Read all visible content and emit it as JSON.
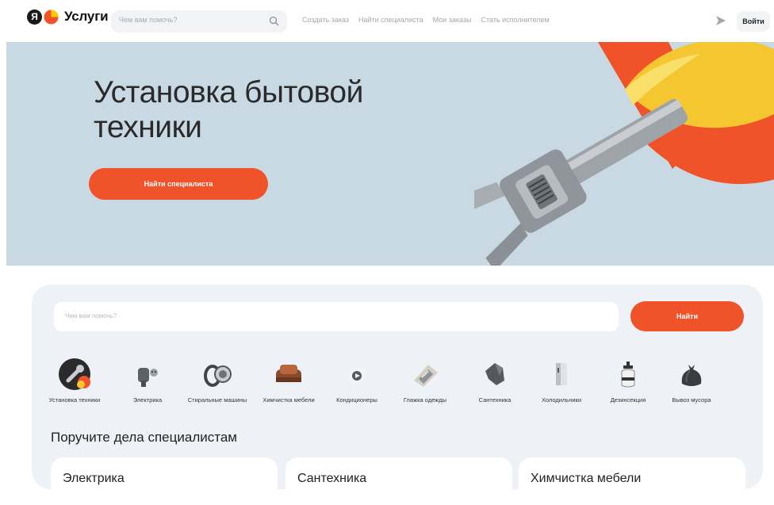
{
  "header": {
    "logo_letter": "Я",
    "logo_text": "Услуги",
    "search_placeholder": "Чем вам помочь?",
    "nav": [
      "Создать заказ",
      "Найти специалиста",
      "Мои заказы",
      "Стать исполнителем"
    ],
    "login_label": "Войти"
  },
  "hero": {
    "title": "Установка бытовой техники",
    "button_label": "Найти специалиста"
  },
  "search": {
    "placeholder": "Чем вам помочь?",
    "button_label": "Найти"
  },
  "categories": [
    {
      "label": "Установка техники",
      "icon": "wrench-icon"
    },
    {
      "label": "Электрика",
      "icon": "socket-icon"
    },
    {
      "label": "Стиральные машины",
      "icon": "washing-machine-icon"
    },
    {
      "label": "Химчистка мебели",
      "icon": "sofa-icon"
    },
    {
      "label": "Кондиционеры",
      "icon": "air-conditioner-icon"
    },
    {
      "label": "Глажка одежды",
      "icon": "iron-icon"
    },
    {
      "label": "Сантехника",
      "icon": "pipe-icon"
    },
    {
      "label": "Холодильники",
      "icon": "fridge-icon"
    },
    {
      "label": "Дезинсекция",
      "icon": "sprayer-icon"
    },
    {
      "label": "Вывоз мусора",
      "icon": "trash-bag-icon"
    }
  ],
  "section": {
    "title": "Поручите дела специалистам",
    "cards": [
      "Электрика",
      "Сантехника",
      "Химчистка мебели"
    ]
  },
  "colors": {
    "accent": "#f0522a",
    "hero_bg": "#c9d9e4",
    "panel_bg": "#eef2f7"
  }
}
